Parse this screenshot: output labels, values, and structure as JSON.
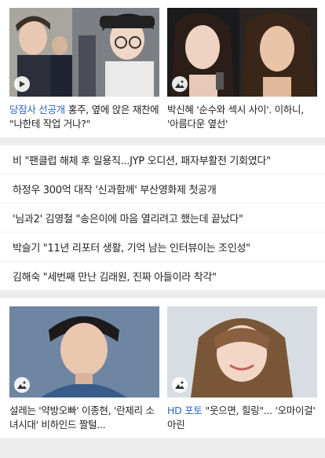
{
  "top_cards": [
    {
      "tag": "당잠사 선공개",
      "text": "홍주, 옆에 앉은 재찬에 \"나한테 작업 거나?\"",
      "media": "play-icon"
    },
    {
      "tag": "",
      "text": "박신혜 '순수와 섹시 사이'. 이하니, '아름다운 옆선'",
      "media": "photo-icon"
    }
  ],
  "headlines": [
    "비 \"팬클럽 해체 후 일용직...JYP 오디션, 패자부활전 기회였다\"",
    "하정우 300억 대작 '신과함께' 부산영화제 첫공개",
    "'님과2' 김영철 \"송은이에 마음 열리려고 했는데 끝났다\"",
    "박슬기 \"11년 리포터 생활, 기억 남는 인터뷰이는 조인성\"",
    "김해숙 \"세번째 만난 김래원, 진짜 아들이라 착각\""
  ],
  "bottom_cards": [
    {
      "tag": "",
      "text": "설레는 '약방오빠' 이종현, '란제리 소녀시대' 비하인드 짤털...",
      "media": "photo-icon"
    },
    {
      "tag": "HD 포토",
      "text": "\"웃으면, 힐링\"... '오마이걸' 아린",
      "media": "photo-icon"
    }
  ],
  "colors": {
    "tag_blue": "#2b64c8",
    "divider": "#ededed"
  }
}
